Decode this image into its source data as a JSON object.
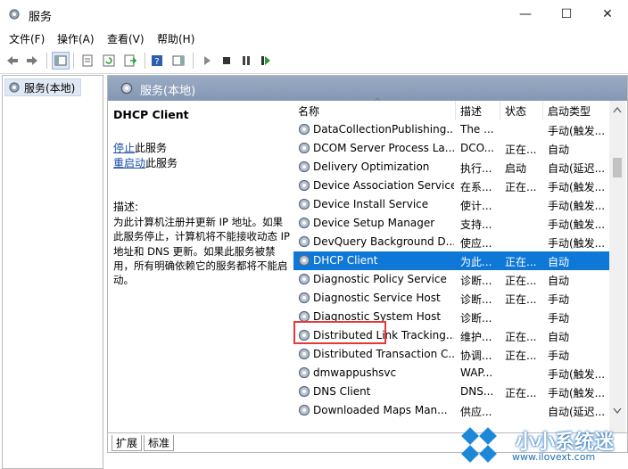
{
  "window": {
    "title": "服务",
    "minimize_glyph": "—",
    "maximize_glyph": "☐",
    "close_glyph": "✕"
  },
  "menu": [
    "文件(F)",
    "操作(A)",
    "查看(V)",
    "帮助(H)"
  ],
  "tree": {
    "root": "服务(本地)"
  },
  "panel": {
    "title": "服务(本地)"
  },
  "desc": {
    "service_name": "DHCP Client",
    "stop_link": "停止",
    "stop_suffix": "此服务",
    "restart_link": "重启动",
    "restart_suffix": "此服务",
    "label": "描述:",
    "text": "为此计算机注册并更新 IP 地址。如果此服务停止，计算机将不能接收动态 IP 地址和 DNS 更新。如果此服务被禁用，所有明确依赖它的服务都将不能启动。"
  },
  "columns": [
    "名称",
    "描述",
    "状态",
    "启动类型"
  ],
  "sort_arrow": "^",
  "services": [
    {
      "name": "DataCollectionPublishing...",
      "desc": "The ...",
      "status": "",
      "startup": "手动(触发..."
    },
    {
      "name": "DCOM Server Process La...",
      "desc": "DCO...",
      "status": "正在...",
      "startup": "自动"
    },
    {
      "name": "Delivery Optimization",
      "desc": "执行...",
      "status": "启动",
      "startup": "自动(延迟..."
    },
    {
      "name": "Device Association Service",
      "desc": "在系...",
      "status": "正在...",
      "startup": "手动(触发..."
    },
    {
      "name": "Device Install Service",
      "desc": "使计...",
      "status": "",
      "startup": "手动(触发..."
    },
    {
      "name": "Device Setup Manager",
      "desc": "支持...",
      "status": "",
      "startup": "手动(触发..."
    },
    {
      "name": "DevQuery Background D...",
      "desc": "使应...",
      "status": "",
      "startup": "手动(触发..."
    },
    {
      "name": "DHCP Client",
      "desc": "为此...",
      "status": "正在...",
      "startup": "自动"
    },
    {
      "name": "Diagnostic Policy Service",
      "desc": "诊断...",
      "status": "正在...",
      "startup": "自动"
    },
    {
      "name": "Diagnostic Service Host",
      "desc": "诊断...",
      "status": "正在...",
      "startup": "手动"
    },
    {
      "name": "Diagnostic System Host",
      "desc": "诊断...",
      "status": "",
      "startup": "手动"
    },
    {
      "name": "Distributed Link Tracking...",
      "desc": "维护...",
      "status": "正在...",
      "startup": "自动"
    },
    {
      "name": "Distributed Transaction C...",
      "desc": "协调...",
      "status": "正在...",
      "startup": "手动"
    },
    {
      "name": "dmwappushsvc",
      "desc": "WAP...",
      "status": "",
      "startup": "手动(触发..."
    },
    {
      "name": "DNS Client",
      "desc": "DNS...",
      "status": "正在...",
      "startup": "手动(触发..."
    },
    {
      "name": "Downloaded Maps Man...",
      "desc": "供应...",
      "status": "",
      "startup": "自动(延迟..."
    }
  ],
  "selected_index": 7,
  "tabs": [
    "扩展",
    "标准"
  ],
  "watermark": {
    "brand": "小小系统迷",
    "url": "www.ilovext.com"
  },
  "colors": {
    "selection": "#0f78d7",
    "highlight_box": "#e23a3a",
    "header_bar": "#8fa1bb",
    "link": "#1a4ea6"
  }
}
